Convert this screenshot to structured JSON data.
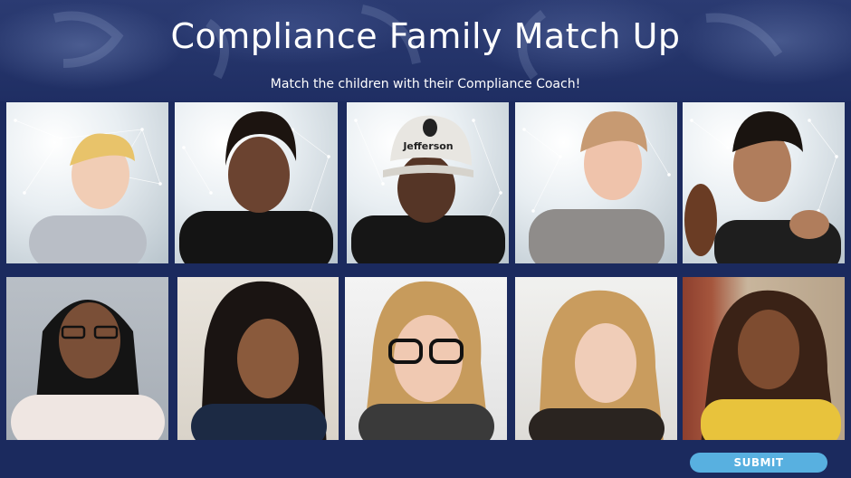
{
  "header": {
    "title": "Compliance Family Match Up",
    "subtitle": "Match the children with their Compliance Coach!"
  },
  "children": [
    {
      "name": "child-photo-1",
      "hair": "#e8c36a",
      "skin": "#f1cdb5",
      "shirt": "#b9bec6"
    },
    {
      "name": "child-photo-2",
      "hair": "#1c1410",
      "skin": "#6b4330",
      "shirt": "#141414"
    },
    {
      "name": "child-photo-3",
      "hair": "#1c1410",
      "skin": "#553526",
      "shirt": "#161616",
      "cap": "#e8e6e1",
      "cap_text": "Jefferson"
    },
    {
      "name": "child-photo-4",
      "hair": "#c79a72",
      "skin": "#efc3ab",
      "shirt": "#8f8c8a"
    },
    {
      "name": "child-photo-5",
      "hair": "#1a1410",
      "skin": "#b07d5c",
      "shirt": "#1e1e1e"
    }
  ],
  "coaches": [
    {
      "name": "coach-photo-1",
      "hair": "#141414",
      "skin": "#7a4f37",
      "shirt": "#efe6e2"
    },
    {
      "name": "coach-photo-2",
      "hair": "#1a1412",
      "skin": "#8a5a3c",
      "shirt": "#1c2a44"
    },
    {
      "name": "coach-photo-3",
      "hair": "#c79b5c",
      "skin": "#f0c9b2",
      "shirt": "#3a3a3a"
    },
    {
      "name": "coach-photo-4",
      "hair": "#c99c5e",
      "skin": "#f0cdb8",
      "shirt": "#2a2420"
    },
    {
      "name": "coach-photo-5",
      "hair": "#3a2216",
      "skin": "#7e4c30",
      "shirt": "#e8c33c"
    }
  ],
  "submit": {
    "label": "SUBMIT"
  },
  "colors": {
    "background": "#1b2a5e",
    "accent": "#58b0e0",
    "text": "#ffffff"
  }
}
